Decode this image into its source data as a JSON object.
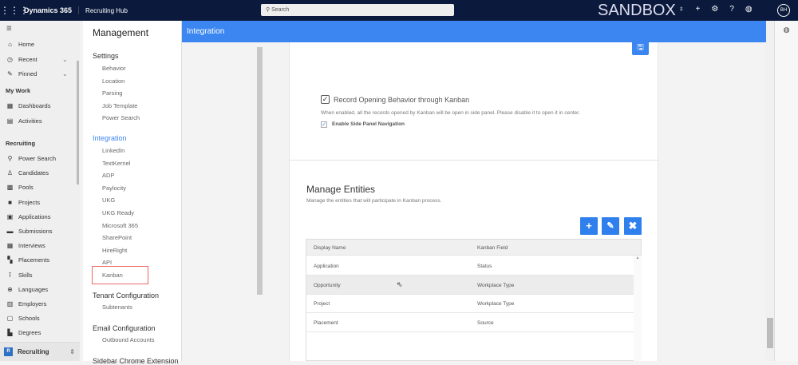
{
  "topbar": {
    "brand": "Dynamics 365",
    "app": "Recruiting Hub",
    "search_placeholder": "Search",
    "env": "SANDBOX",
    "avatar": "BH"
  },
  "leftnav": {
    "items": [
      {
        "label": "Home",
        "icon": "⌂"
      },
      {
        "label": "Recent",
        "icon": "◷"
      },
      {
        "label": "Pinned",
        "icon": "✎"
      }
    ],
    "mywork_title": "My Work",
    "mywork": [
      {
        "label": "Dashboards",
        "icon": "▦"
      },
      {
        "label": "Activities",
        "icon": "▤"
      }
    ],
    "recruiting_title": "Recruiting",
    "recruiting": [
      {
        "label": "Power Search",
        "icon": "⚲"
      },
      {
        "label": "Candidates",
        "icon": "♙"
      },
      {
        "label": "Pools",
        "icon": "▩"
      },
      {
        "label": "Projects",
        "icon": "■"
      },
      {
        "label": "Applications",
        "icon": "▣"
      },
      {
        "label": "Submissions",
        "icon": "▬"
      },
      {
        "label": "Interviews",
        "icon": "▦"
      },
      {
        "label": "Placements",
        "icon": "▚"
      },
      {
        "label": "Skills",
        "icon": "ĭ"
      },
      {
        "label": "Languages",
        "icon": "⊕"
      },
      {
        "label": "Employers",
        "icon": "▥"
      },
      {
        "label": "Schools",
        "icon": "▢"
      },
      {
        "label": "Degrees",
        "icon": "▙"
      }
    ],
    "area": "Recruiting",
    "area_initial": "R"
  },
  "management": {
    "title": "Management",
    "settings": "Settings",
    "settings_items": [
      "Behavior",
      "Location",
      "Parsing",
      "Job Template",
      "Power Search"
    ],
    "integration": "Integration",
    "integration_items": [
      "LinkedIn",
      "TextKernel",
      "ADP",
      "Paylocity",
      "UKG",
      "UKG Ready",
      "Microsoft 365",
      "SharePoint",
      "HireRight",
      "API",
      "Kanban"
    ],
    "tenant": "Tenant Configuration",
    "tenant_items": [
      "Subtenants"
    ],
    "email": "Email Configuration",
    "email_items": [
      "Outbound Accounts"
    ],
    "chrome": "Sidebar Chrome Extension"
  },
  "main": {
    "header": "Integration",
    "record_label": "Record Opening Behavior through Kanban",
    "record_desc": "When enabled, all the records opened by Kanban will be open in side panel. Please disable it to open it in center.",
    "side_panel_label": "Enable Side Panel Navigation",
    "manage_title": "Manage Entities",
    "manage_desc": "Manage the entities that will participate in Kanban process.",
    "table": {
      "headers": [
        "Display Name",
        "Kanban Field"
      ],
      "rows": [
        [
          "Application",
          "Status"
        ],
        [
          "Opportunity",
          "Workplace Type"
        ],
        [
          "Project",
          "Workplace Type"
        ],
        [
          "Placement",
          "Source"
        ]
      ]
    }
  },
  "colors": {
    "accent": "#3b86f0",
    "topbar": "#0b1a3c"
  }
}
